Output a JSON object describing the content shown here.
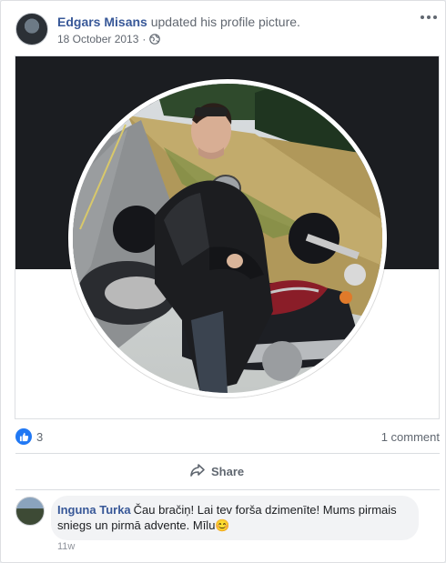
{
  "post": {
    "author": "Edgars Misans",
    "action": "updated his profile picture.",
    "date": "18 October 2013",
    "separator": "·",
    "privacy_icon": "globe-icon",
    "more_icon": "more-options-icon"
  },
  "reactions": {
    "like_count": "3",
    "comment_count": "1 comment"
  },
  "actions": {
    "share_label": "Share"
  },
  "comment": {
    "author": "Inguna Turka",
    "text": "Čau bračiņ! Lai tev forša dzimenīte! Mums pirmais sniegs un pirmā advente. Mīlu😊",
    "time": "11w"
  },
  "colors": {
    "link": "#385898",
    "like_blue": "#2078f4",
    "cover_dark": "#1b1d21"
  }
}
